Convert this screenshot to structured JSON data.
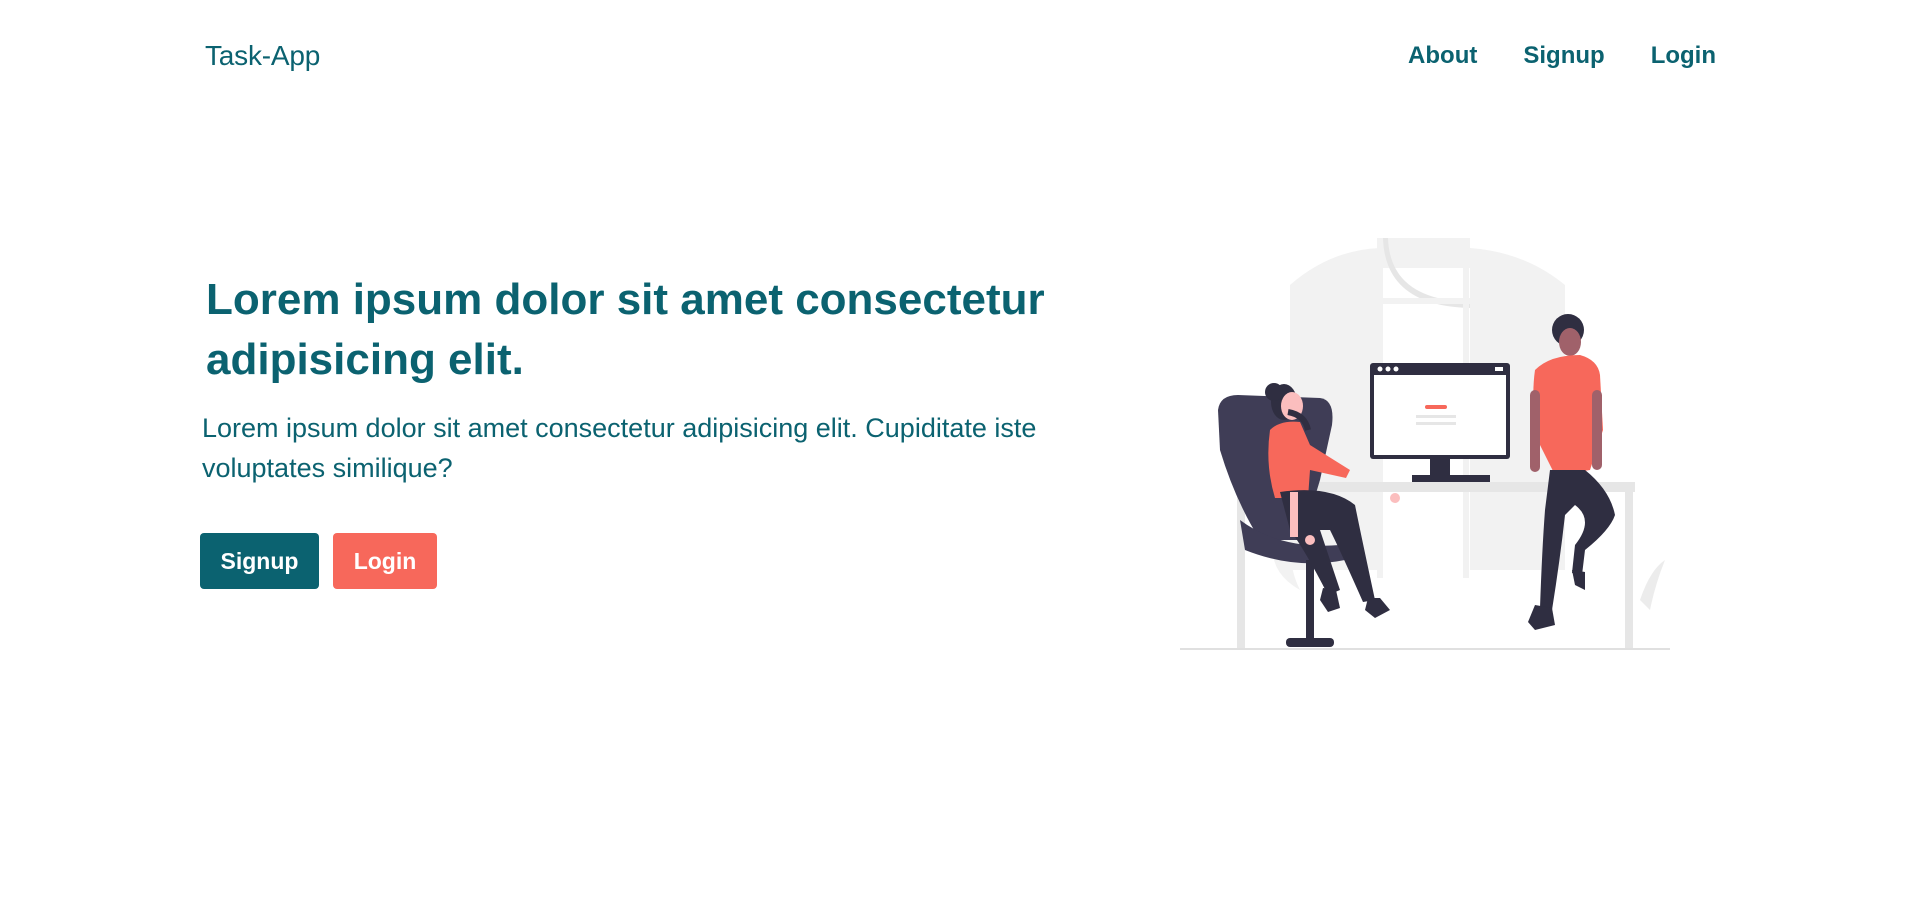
{
  "navbar": {
    "brand": "Task-App",
    "links": [
      "About",
      "Signup",
      "Login"
    ]
  },
  "hero": {
    "title": "Lorem ipsum dolor sit amet consectetur adipisicing elit.",
    "subtitle": "Lorem ipsum dolor sit amet consectetur adipisicing elit. Cupiditate iste voluptates similique?",
    "signup_label": "Signup",
    "login_label": "Login"
  },
  "colors": {
    "primary": "#0b6270",
    "accent": "#f7685b",
    "dark": "#2f2e41",
    "light_gray": "#f2f2f2"
  },
  "illustration": {
    "icon": "people-at-desk-illustration"
  }
}
